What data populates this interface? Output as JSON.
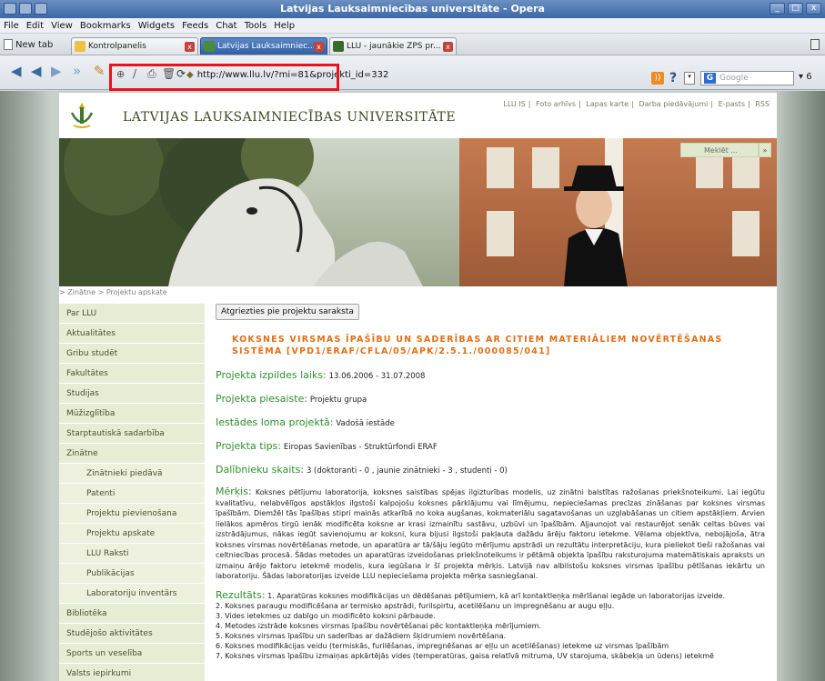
{
  "browser": {
    "window_title": "Latvijas Lauksaimniecības universitāte - Opera",
    "menu": [
      "File",
      "Edit",
      "View",
      "Bookmarks",
      "Widgets",
      "Feeds",
      "Chat",
      "Tools",
      "Help"
    ],
    "new_tab_label": "New tab",
    "tabs": [
      {
        "label": "Kontrolpanelis"
      },
      {
        "label": "Latvijas Lauksaimniec..."
      },
      {
        "label": "LLU - jaunākie ZPS pr..."
      }
    ],
    "url": "http://www.llu.lv/?mi=81&projekti_id=332",
    "search_placeholder": "Google"
  },
  "site": {
    "name": "Latvijas Lauksaimniecības universitāte",
    "top_links": [
      "LLU IS",
      "Foto arhīvs",
      "Lapas karte",
      "Darba piedāvājumi",
      "E-pasts",
      "RSS"
    ],
    "search_placeholder": "Meklēt ...",
    "search_button": "»",
    "breadcrumb": "> Zinātne > Projektu apskate"
  },
  "sidebar": {
    "items": [
      {
        "label": "Par LLU",
        "sub": false
      },
      {
        "label": "Aktualitātes",
        "sub": false
      },
      {
        "label": "Gribu studēt",
        "sub": false
      },
      {
        "label": "Fakultātes",
        "sub": false
      },
      {
        "label": "Studijas",
        "sub": false
      },
      {
        "label": "Mūžizglītība",
        "sub": false
      },
      {
        "label": "Starptautiskā sadarbība",
        "sub": false
      },
      {
        "label": "Zinātne",
        "sub": false
      },
      {
        "label": "Zinātnieki piedāvā",
        "sub": true
      },
      {
        "label": "Patenti",
        "sub": true
      },
      {
        "label": "Projektu pievienošana",
        "sub": true
      },
      {
        "label": "Projektu apskate",
        "sub": true
      },
      {
        "label": "LLU Raksti",
        "sub": true
      },
      {
        "label": "Publikācijas",
        "sub": true
      },
      {
        "label": "Laboratoriju inventārs",
        "sub": true
      },
      {
        "label": "Bibliotēka",
        "sub": false
      },
      {
        "label": "Studējošo aktivitātes",
        "sub": false
      },
      {
        "label": "Sports un veselība",
        "sub": false
      },
      {
        "label": "Valsts iepirkumi",
        "sub": false
      }
    ]
  },
  "content": {
    "back_button": "Atgriezties pie projektu saraksta",
    "title": "Koksnes virsmas īpašību un saderības ar citiem materiāliem novērtēšanas sistēma [VPD1/ERAF/CFLA/05/APK/2.5.1./000085/041]",
    "fields": [
      {
        "label": "Projekta izpildes laiks:",
        "value": "13.06.2006 - 31.07.2008"
      },
      {
        "label": "Projekta piesaiste:",
        "value": "Projektu grupa"
      },
      {
        "label": "Iestādes loma projektā:",
        "value": "Vadošā iestāde"
      },
      {
        "label": "Projekta tips:",
        "value": "Eiropas Savienības - Struktūrfondi ERAF"
      },
      {
        "label": "Dalībnieku skaits:",
        "value": "3 (doktoranti - 0 , jaunie zinātnieki - 3 , studenti - 0)"
      }
    ],
    "goal_label": "Mērķis:",
    "goal_text": "Koksnes pētījumu laboratorija, koksnes saistības spējas ilgizturības modelis, uz zinātni balstītas ražošanas priekšnoteikumi. Lai iegūtu kvalitatīvu, nelabvēlīgos apstākļos ilgstoši kalpojošu koksnes pārklājumu vai līmējumu, nepieciešamas precīzas zināšanas par koksnes virsmas īpašībām. Diemžēl tās īpašības stipri mainās atkarībā no koka augšanas, kokmateriālu sagatavošanas un uzglabāšanas un citiem apstākļiem. Arvien lielākos apmēros tirgū ienāk modificēta koksne ar krasi izmainītu sastāvu, uzbūvi un īpašībām. Aļjaunojot vai restaurējot senāk celtas būves vai izstrādājumus, nākas iegūt savienojumu ar koksni, kura bijusi ilgstoši pakļauta dažādu ārēju faktoru ietekme. Vēlama objektīva, nebojājoša, ātra koksnes virsmas novērtēšanas metode, un aparatūra ar tā/šāju iegūto mērījumu apstrādi un rezultātu interpretāciju, kura pieliekot tieši ražošanas vai celtniecības procesā. Šādas metodes un aparatūras izveidošanas priekšnoteikums ir pētāmā objekta īpašību raksturojuma matemātiskais apraksts un izmaiņu ārējo faktoru ietekmē modelis, kura iegūšana ir šī projekta mērķis. Latvijā nav albilstošu koksnes virsmas īpašību pētīšanas iekārtu un laboratoriju. Šādas laboratorijas izveide LLU nepieciešama projekta mērķa sasniegšanai.",
    "results_label": "Rezultāts:",
    "results": [
      "1. Aparatūras koksnes modifikācijas un dēdēšanas pētījumiem, kā arī kontaktleņķa mērīšanai iegāde un laboratorijas izveide.",
      "2. Koksnes paraugu modificēšana ar termisko apstrādi, furilspirtu, acetilēšanu un impregnēšanu ar augu eļļu.",
      "3. Vides ietekmes uz dabīgo un modificēto koksni pārbaude.",
      "4. Metodes izstrāde koksnes virsmas īpašību novērtēšanai pēc kontaktleņķa mērījumiem.",
      "5. Koksnes virsmas īpašību un saderības ar dažādiem šķidrumiem novērtēšana.",
      "6. Koksnes modifikācijas veidu (termiskās, furilēšanas, impregnēšanas ar eļļu un acetilēšanas) ietekme uz virsmas īpašībām",
      "7. Koksnes virsmas īpašību izmaiņas apkārtējās vides (temperatūras, gaisa relatīvā mitruma, UV starojuma, skābekļa un ūdens) ietekmē"
    ]
  },
  "colors": {
    "accent_orange": "#e36f14",
    "label_green": "#2d8f2d",
    "sidebar_bg": "#e7ecd4",
    "highlight_red": "#e8141c"
  }
}
